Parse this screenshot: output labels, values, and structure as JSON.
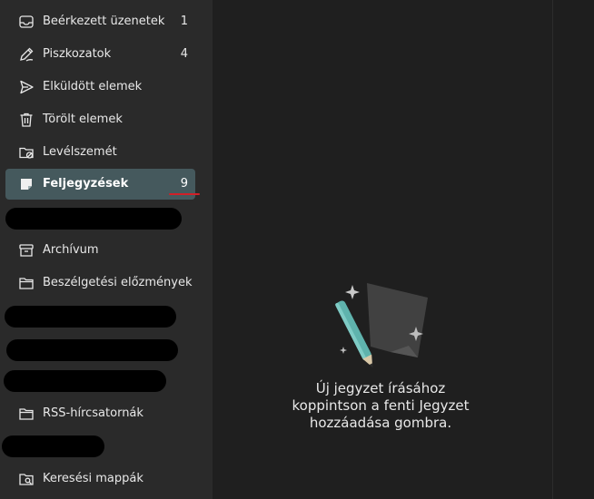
{
  "sidebar": {
    "folders": [
      {
        "label": "Beérkezett üzenetek",
        "count": "1",
        "icon": "inbox-icon"
      },
      {
        "label": "Piszkozatok",
        "count": "4",
        "icon": "pencil-icon"
      },
      {
        "label": "Elküldött elemek",
        "count": "",
        "icon": "send-icon"
      },
      {
        "label": "Törölt elemek",
        "count": "",
        "icon": "trash-icon"
      },
      {
        "label": "Levélszemét",
        "count": "",
        "icon": "junk-folder-icon"
      },
      {
        "label": "Feljegyzések",
        "count": "9",
        "icon": "note-icon",
        "selected": true
      },
      {
        "label": "Archívum",
        "count": "",
        "icon": "archive-icon"
      },
      {
        "label": "Beszélgetési előzmények",
        "count": "",
        "icon": "folder-icon"
      },
      {
        "label": "RSS-hírcsatornák",
        "count": "",
        "icon": "folder-icon"
      },
      {
        "label": "Keresési mappák",
        "count": "",
        "icon": "search-folder-icon"
      }
    ]
  },
  "main": {
    "empty_state": {
      "line1": "Új jegyzet írásához",
      "line2": "koppintson a fenti Jegyzet",
      "line3": "hozzáadása gombra.",
      "illustration_icon": "note-pencil-illustration"
    }
  },
  "colors": {
    "sidebar_bg": "#2a2a2a",
    "main_bg": "#1f1f1f",
    "selected_bg": "#45595d",
    "accent_underline": "#d21f28",
    "pencil_teal": "#5fb3ad"
  }
}
